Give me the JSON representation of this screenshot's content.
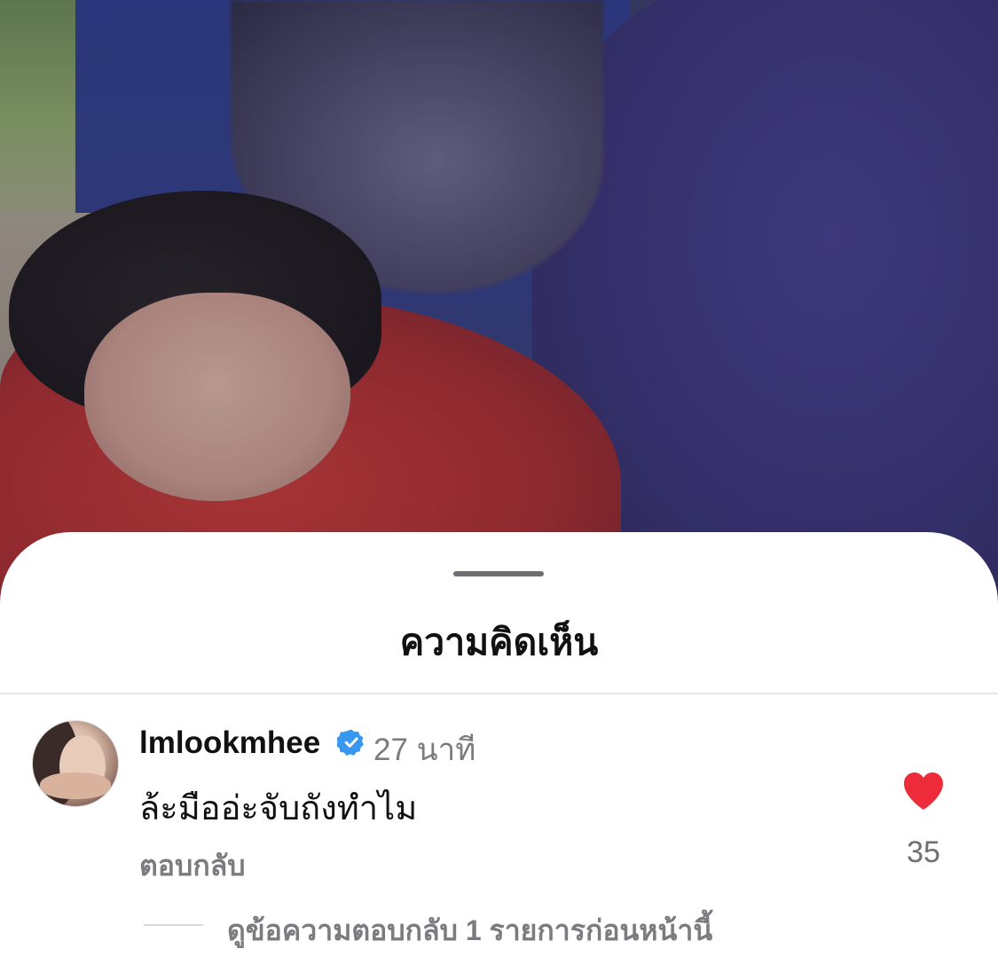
{
  "sheet": {
    "title": "ความคิดเห็น"
  },
  "comment": {
    "username": "lmlookmhee",
    "verified": true,
    "time": "27 นาที",
    "text": "ล้ะมืออ่ะจับถังทำไม",
    "reply_label": "ตอบกลับ",
    "likes": "35",
    "view_replies_label": "ดูข้อความตอบกลับ 1 รายการก่อนหน้านี้"
  },
  "colors": {
    "heart": "#ee2b3b",
    "verified_badge": "#3897f0",
    "secondary_text": "#7b7b80"
  },
  "icons": {
    "like": "heart-filled-icon",
    "verified": "verified-badge-icon"
  }
}
